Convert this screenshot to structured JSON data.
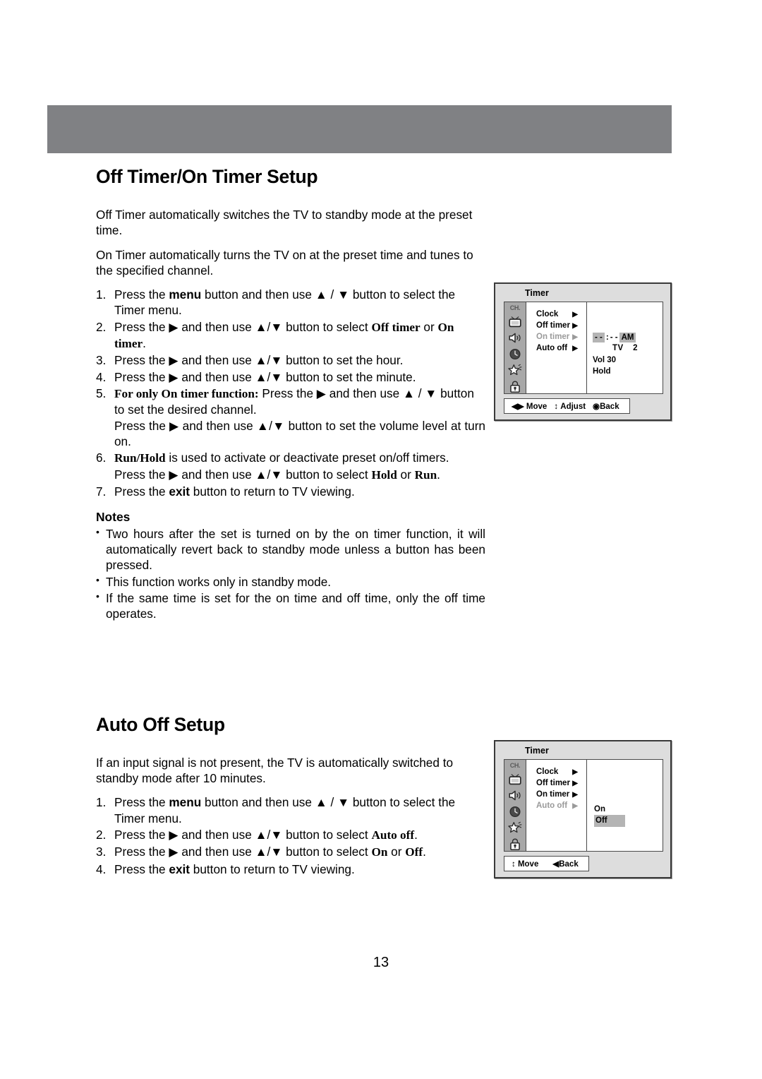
{
  "page": {
    "number": "13"
  },
  "section1": {
    "title": "Off Timer/On Timer Setup",
    "intro1": "Off Timer automatically switches the TV to standby mode at the preset time.",
    "intro2": "On Timer automatically turns the TV on at the preset time and tunes to the specified channel.",
    "steps": [
      {
        "num": "1.",
        "pre": "Press the ",
        "b1": "menu",
        "mid": " button and then use ▲ / ▼ button to select the Timer menu.",
        "b2": "",
        "post": ""
      },
      {
        "num": "2.",
        "pre": "Press the ▶ and then use ▲/▼ button to select ",
        "b1": "Off timer",
        "mid": " or ",
        "b2": "On timer",
        "post": "."
      },
      {
        "num": "3.",
        "pre": "Press the ▶ and then use ▲/▼ button to set the hour.",
        "b1": "",
        "mid": "",
        "b2": "",
        "post": ""
      },
      {
        "num": "4.",
        "pre": "Press the ▶ and then use ▲/▼ button to set the minute.",
        "b1": "",
        "mid": "",
        "b2": "",
        "post": ""
      },
      {
        "num": "5.",
        "pre": "",
        "b1": "For only On timer function:",
        "mid": " Press the ▶ and then use ▲ / ▼ button to set the desired channel.",
        "b2": "",
        "post": "",
        "extra": "Press the ▶ and then use ▲/▼ button to set the volume level at turn on."
      },
      {
        "num": "6.",
        "pre": "",
        "b1": "Run/Hold",
        "mid": " is used to activate or deactivate preset on/off timers.",
        "b2": "",
        "post": "",
        "extra2_pre": "Press the ▶ and then use ▲/▼ button to select ",
        "extra2_b1": "Hold",
        "extra2_mid": " or ",
        "extra2_b2": "Run",
        "extra2_post": "."
      },
      {
        "num": "7.",
        "pre": "Press the ",
        "b1": "exit",
        "mid": " button to return to TV viewing.",
        "b2": "",
        "post": ""
      }
    ],
    "notes_heading": "Notes",
    "notes": [
      "Two hours after the set is turned on by the on timer function, it will automatically revert back to standby mode unless a button has been pressed.",
      "This function works only in standby mode.",
      "If the same time is set for the on time and off time, only the off time operates."
    ]
  },
  "section2": {
    "title": "Auto Off Setup",
    "intro1": "If an input signal is not present, the TV is automatically switched to standby mode after 10 minutes.",
    "steps": [
      {
        "num": "1.",
        "pre": "Press the ",
        "b1": "menu",
        "mid": " button and then use ▲ / ▼ button to select the Timer menu.",
        "b2": "",
        "post": ""
      },
      {
        "num": "2.",
        "pre": "Press the ▶ and then use ▲/▼ button to select ",
        "b1": "Auto off",
        "mid": "",
        "b2": "",
        "post": "."
      },
      {
        "num": "3.",
        "pre": "Press the ▶ and then use ▲/▼ button to select ",
        "b1": "On",
        "mid": " or ",
        "b2": "Off",
        "post": "."
      },
      {
        "num": "4.",
        "pre": "Press the ",
        "b1": "exit",
        "mid": " button to return to TV viewing.",
        "b2": "",
        "post": ""
      }
    ]
  },
  "osd1": {
    "title": "Timer",
    "rail": {
      "ch_label": "CH.",
      "icons": [
        "tv-icon",
        "speaker-icon",
        "clock-icon",
        "star-icon",
        "lock-icon"
      ]
    },
    "menu": [
      {
        "label": "Clock",
        "arrow": "▶",
        "dim": false
      },
      {
        "label": "Off timer",
        "arrow": "▶",
        "dim": false
      },
      {
        "label": "On timer",
        "arrow": "▶",
        "dim": true
      },
      {
        "label": "Auto off",
        "arrow": "▶",
        "dim": false
      }
    ],
    "panel": {
      "hour": "- -",
      "colon": ":",
      "minute": "- -",
      "meridiem": "AM",
      "source": "TV",
      "channel": "2",
      "volume": "Vol 30",
      "run_hold": "Hold"
    },
    "footer": {
      "move_icon": "◀▶",
      "move": "Move",
      "adjust_icon": "↕",
      "adjust": "Adjust",
      "back_icon": "◉",
      "back": "Back"
    }
  },
  "osd2": {
    "title": "Timer",
    "rail": {
      "ch_label": "CH.",
      "icons": [
        "tv-icon",
        "speaker-icon",
        "clock-icon",
        "star-icon",
        "lock-icon"
      ]
    },
    "menu": [
      {
        "label": "Clock",
        "arrow": "▶",
        "dim": false
      },
      {
        "label": "Off timer",
        "arrow": "▶",
        "dim": false
      },
      {
        "label": "On timer",
        "arrow": "▶",
        "dim": false
      },
      {
        "label": "Auto off",
        "arrow": "▶",
        "dim": true
      }
    ],
    "panel": {
      "option_on": "On",
      "option_off": "Off",
      "selected": "Off"
    },
    "footer": {
      "move_icon": "↕",
      "move": "Move",
      "back_icon": "◀",
      "back": "Back"
    }
  }
}
